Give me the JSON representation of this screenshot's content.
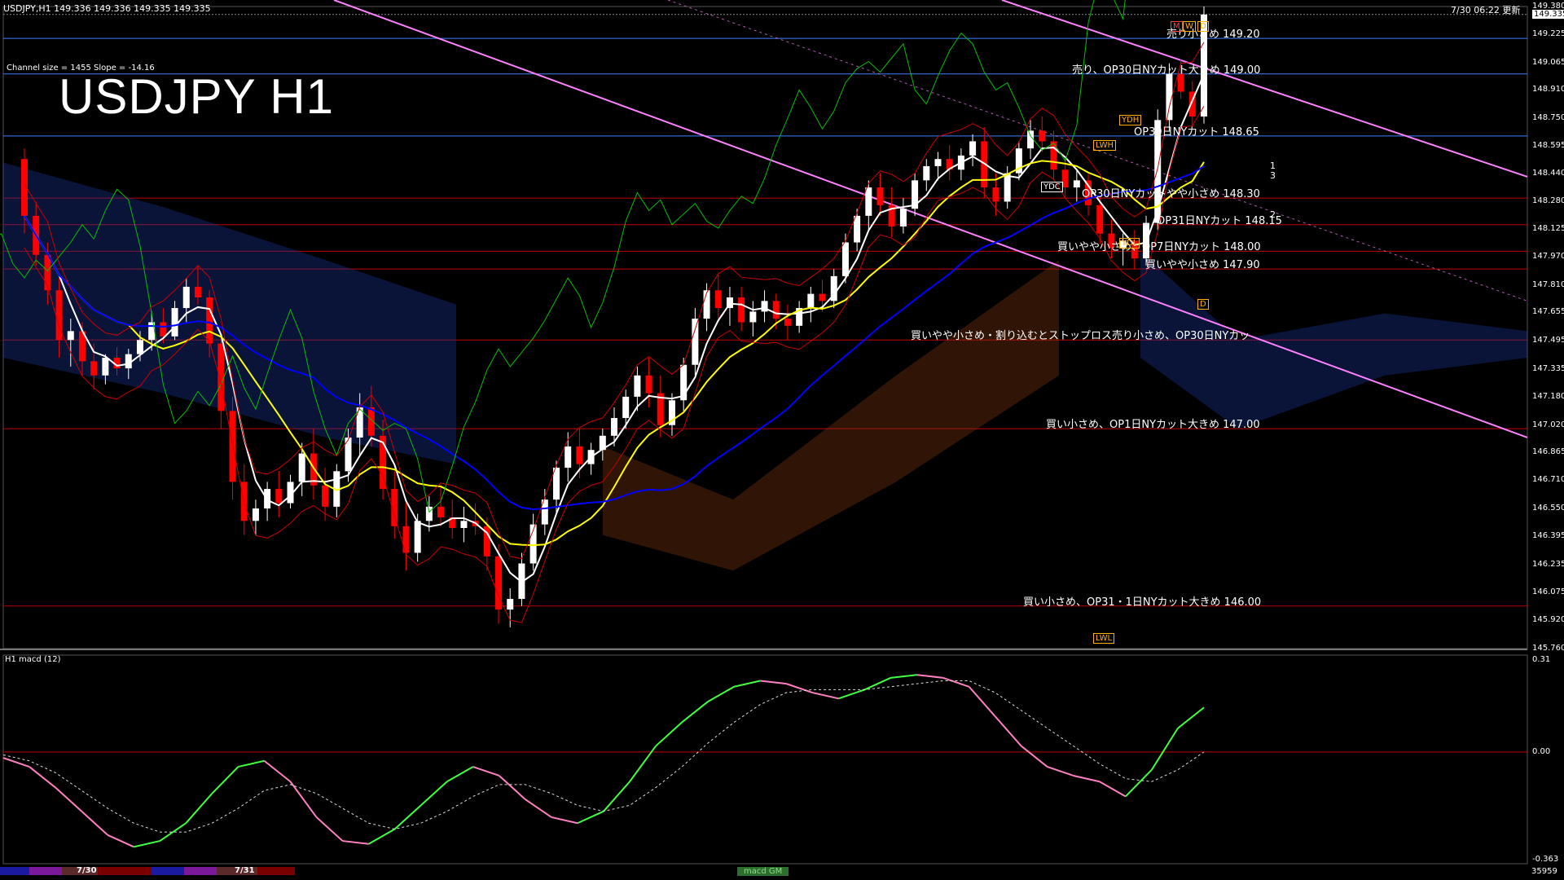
{
  "header": {
    "symbol_info": "USDJPY,H1  149.336 149.336 149.335 149.335",
    "timestamp": "7/30 06:22 更新",
    "channel_info": "Channel size = 1455 Slope = -14.16",
    "title": "USDJPY H1",
    "current_price": "149.335"
  },
  "price_axis": [
    "149.380",
    "149.225",
    "149.065",
    "148.910",
    "148.750",
    "148.595",
    "148.440",
    "148.280",
    "148.125",
    "147.970",
    "147.810",
    "147.655",
    "147.495",
    "147.335",
    "147.180",
    "147.020",
    "146.865",
    "146.710",
    "146.550",
    "146.395",
    "146.235",
    "146.075",
    "145.920",
    "145.760"
  ],
  "levels": [
    {
      "price": 149.2,
      "label": "売り小さめ 149.20"
    },
    {
      "price": 149.0,
      "label": "売り、OP30日NYカット大きめ 149.00"
    },
    {
      "price": 148.65,
      "label": "OP30日NYカット 148.65"
    },
    {
      "price": 148.3,
      "label": "OP30日NYカットやや小さめ 148.30"
    },
    {
      "price": 148.15,
      "label": "OP31日NYカット 148.15"
    },
    {
      "price": 148.0,
      "label": "買いやや小さめ、OP7日NYカット 148.00"
    },
    {
      "price": 147.9,
      "label": "買いやや小さめ 147.90"
    },
    {
      "price": 147.5,
      "label": "買いやや小さめ・割り込むとストップロス売り小さめ、OP30日NYカッ"
    },
    {
      "price": 147.0,
      "label": "買い小さめ、OP1日NYカット大きめ 147.00"
    },
    {
      "price": 146.0,
      "label": "買い小さめ、OP31・1日NYカット大きめ 146.00"
    }
  ],
  "tags": {
    "m": "M",
    "w": "W",
    "d": "D",
    "ydh": "YDH",
    "lwh": "LWH",
    "ydc": "YDC",
    "ydl": "YDL",
    "lwl": "LWL",
    "d2": "D",
    "fib1": "1",
    "fib3": "3",
    "fib2": "2"
  },
  "macd_panel": {
    "label": "H1  macd (12)",
    "axis": [
      "0.31",
      "0.00",
      "-0.363"
    ]
  },
  "footer": {
    "date1": "7/30",
    "date2": "7/31",
    "tab": "macd GM",
    "bars": "35959"
  },
  "colors": {
    "background": "#000000",
    "bull_candle": "#ffffff",
    "bear_candle": "#ff0000",
    "ma_short": "#ffffff",
    "ma_mid": "#ffff00",
    "ma_long": "#0000ff",
    "chikou": "#00c000",
    "channel": "#ff80ff",
    "level_red": "#c00000",
    "level_blue": "#4080ff",
    "macd_up": "#40ff40",
    "macd_down": "#ff80c0"
  },
  "chart_data": {
    "type": "candlestick",
    "symbol": "USDJPY",
    "timeframe": "H1",
    "y_range": [
      145.76,
      149.38
    ],
    "candles": [
      [
        148.52,
        148.58,
        148.1,
        148.2
      ],
      [
        148.2,
        148.28,
        147.92,
        147.98
      ],
      [
        147.98,
        148.05,
        147.7,
        147.78
      ],
      [
        147.78,
        147.85,
        147.4,
        147.5
      ],
      [
        147.5,
        147.62,
        147.35,
        147.55
      ],
      [
        147.55,
        147.6,
        147.3,
        147.38
      ],
      [
        147.38,
        147.48,
        147.22,
        147.3
      ],
      [
        147.3,
        147.42,
        147.25,
        147.4
      ],
      [
        147.4,
        147.46,
        147.3,
        147.34
      ],
      [
        147.34,
        147.45,
        147.28,
        147.42
      ],
      [
        147.42,
        147.55,
        147.38,
        147.5
      ],
      [
        147.5,
        147.66,
        147.44,
        147.6
      ],
      [
        147.6,
        147.68,
        147.48,
        147.52
      ],
      [
        147.52,
        147.72,
        147.5,
        147.68
      ],
      [
        147.68,
        147.85,
        147.6,
        147.8
      ],
      [
        147.8,
        147.92,
        147.7,
        147.74
      ],
      [
        147.74,
        147.78,
        147.4,
        147.48
      ],
      [
        147.48,
        147.52,
        147.0,
        147.1
      ],
      [
        147.1,
        147.18,
        146.6,
        146.7
      ],
      [
        146.7,
        146.8,
        146.4,
        146.48
      ],
      [
        146.48,
        146.6,
        146.4,
        146.55
      ],
      [
        146.55,
        146.7,
        146.48,
        146.66
      ],
      [
        146.66,
        146.76,
        146.5,
        146.58
      ],
      [
        146.58,
        146.74,
        146.55,
        146.7
      ],
      [
        146.7,
        146.92,
        146.62,
        146.86
      ],
      [
        146.86,
        147.0,
        146.6,
        146.68
      ],
      [
        146.68,
        146.78,
        146.48,
        146.56
      ],
      [
        146.56,
        146.8,
        146.5,
        146.76
      ],
      [
        146.76,
        147.0,
        146.7,
        146.95
      ],
      [
        146.95,
        147.2,
        146.85,
        147.12
      ],
      [
        147.12,
        147.24,
        146.9,
        146.96
      ],
      [
        146.96,
        147.05,
        146.6,
        146.66
      ],
      [
        146.66,
        146.76,
        146.38,
        146.45
      ],
      [
        146.45,
        146.6,
        146.2,
        146.3
      ],
      [
        146.3,
        146.52,
        146.25,
        146.48
      ],
      [
        146.48,
        146.62,
        146.42,
        146.56
      ],
      [
        146.56,
        146.68,
        146.45,
        146.5
      ],
      [
        146.5,
        146.6,
        146.38,
        146.44
      ],
      [
        146.44,
        146.56,
        146.36,
        146.48
      ],
      [
        146.48,
        146.58,
        146.4,
        146.45
      ],
      [
        146.45,
        146.5,
        146.2,
        146.28
      ],
      [
        146.28,
        146.35,
        145.9,
        145.98
      ],
      [
        145.98,
        146.1,
        145.88,
        146.04
      ],
      [
        146.04,
        146.3,
        146.0,
        146.24
      ],
      [
        146.24,
        146.52,
        146.2,
        146.46
      ],
      [
        146.46,
        146.66,
        146.4,
        146.6
      ],
      [
        146.6,
        146.82,
        146.52,
        146.78
      ],
      [
        146.78,
        146.98,
        146.7,
        146.9
      ],
      [
        146.9,
        147.0,
        146.72,
        146.8
      ],
      [
        146.8,
        146.92,
        146.74,
        146.88
      ],
      [
        146.88,
        147.0,
        146.82,
        146.96
      ],
      [
        146.96,
        147.12,
        146.9,
        147.06
      ],
      [
        147.06,
        147.22,
        147.0,
        147.18
      ],
      [
        147.18,
        147.35,
        147.1,
        147.3
      ],
      [
        147.3,
        147.4,
        147.12,
        147.2
      ],
      [
        147.2,
        147.3,
        146.95,
        147.02
      ],
      [
        147.02,
        147.2,
        146.96,
        147.16
      ],
      [
        147.16,
        147.4,
        147.1,
        147.36
      ],
      [
        147.36,
        147.68,
        147.3,
        147.62
      ],
      [
        147.62,
        147.82,
        147.55,
        147.78
      ],
      [
        147.78,
        147.88,
        147.62,
        147.68
      ],
      [
        147.68,
        147.8,
        147.58,
        147.74
      ],
      [
        147.74,
        147.8,
        147.55,
        147.6
      ],
      [
        147.6,
        147.72,
        147.52,
        147.66
      ],
      [
        147.66,
        147.78,
        147.6,
        147.72
      ],
      [
        147.72,
        147.76,
        147.56,
        147.62
      ],
      [
        147.62,
        147.7,
        147.5,
        147.58
      ],
      [
        147.58,
        147.72,
        147.54,
        147.68
      ],
      [
        147.68,
        147.8,
        147.6,
        147.76
      ],
      [
        147.76,
        147.84,
        147.66,
        147.72
      ],
      [
        147.72,
        147.9,
        147.68,
        147.86
      ],
      [
        147.86,
        148.1,
        147.82,
        148.05
      ],
      [
        148.05,
        148.24,
        148.0,
        148.2
      ],
      [
        148.2,
        148.4,
        148.12,
        148.36
      ],
      [
        148.36,
        148.44,
        148.2,
        148.26
      ],
      [
        148.26,
        148.36,
        148.08,
        148.14
      ],
      [
        148.14,
        148.3,
        148.1,
        148.24
      ],
      [
        148.24,
        148.44,
        148.2,
        148.4
      ],
      [
        148.4,
        148.52,
        148.34,
        148.48
      ],
      [
        148.48,
        148.56,
        148.4,
        148.52
      ],
      [
        148.52,
        148.6,
        148.4,
        148.46
      ],
      [
        148.46,
        148.58,
        148.4,
        148.54
      ],
      [
        148.54,
        148.66,
        148.48,
        148.62
      ],
      [
        148.62,
        148.7,
        148.3,
        148.36
      ],
      [
        148.36,
        148.44,
        148.2,
        148.28
      ],
      [
        148.28,
        148.48,
        148.24,
        148.44
      ],
      [
        148.44,
        148.62,
        148.4,
        148.58
      ],
      [
        148.58,
        148.74,
        148.52,
        148.68
      ],
      [
        148.68,
        148.76,
        148.56,
        148.62
      ],
      [
        148.62,
        148.68,
        148.4,
        148.46
      ],
      [
        148.46,
        148.54,
        148.3,
        148.36
      ],
      [
        148.36,
        148.46,
        148.28,
        148.4
      ],
      [
        148.4,
        148.44,
        148.2,
        148.26
      ],
      [
        148.26,
        148.32,
        148.04,
        148.1
      ],
      [
        148.1,
        148.18,
        147.96,
        148.02
      ],
      [
        148.02,
        148.1,
        147.92,
        148.06
      ],
      [
        148.06,
        148.12,
        147.9,
        147.96
      ],
      [
        147.96,
        148.2,
        147.92,
        148.16
      ],
      [
        148.16,
        148.8,
        148.12,
        148.74
      ],
      [
        148.74,
        149.06,
        148.68,
        149.0
      ],
      [
        149.0,
        149.08,
        148.86,
        148.9
      ],
      [
        148.9,
        148.96,
        148.7,
        148.76
      ],
      [
        148.76,
        149.38,
        148.72,
        149.335
      ]
    ],
    "macd": {
      "axis_range": [
        -0.363,
        0.31
      ],
      "main": [
        -0.02,
        -0.05,
        -0.12,
        -0.2,
        -0.28,
        -0.32,
        -0.3,
        -0.24,
        -0.14,
        -0.05,
        -0.03,
        -0.1,
        -0.22,
        -0.3,
        -0.31,
        -0.26,
        -0.18,
        -0.1,
        -0.05,
        -0.08,
        -0.16,
        -0.22,
        -0.24,
        -0.2,
        -0.1,
        0.02,
        0.1,
        0.17,
        0.22,
        0.24,
        0.23,
        0.2,
        0.18,
        0.21,
        0.25,
        0.26,
        0.25,
        0.22,
        0.12,
        0.02,
        -0.05,
        -0.08,
        -0.1,
        -0.15,
        -0.06,
        0.08,
        0.15
      ],
      "signal": [
        -0.01,
        -0.03,
        -0.07,
        -0.13,
        -0.19,
        -0.24,
        -0.27,
        -0.27,
        -0.24,
        -0.19,
        -0.13,
        -0.11,
        -0.14,
        -0.19,
        -0.24,
        -0.26,
        -0.24,
        -0.2,
        -0.15,
        -0.11,
        -0.11,
        -0.14,
        -0.18,
        -0.2,
        -0.18,
        -0.12,
        -0.05,
        0.03,
        0.1,
        0.16,
        0.2,
        0.21,
        0.21,
        0.21,
        0.22,
        0.23,
        0.24,
        0.24,
        0.2,
        0.14,
        0.08,
        0.02,
        -0.04,
        -0.09,
        -0.1,
        -0.06,
        0.0
      ]
    }
  }
}
